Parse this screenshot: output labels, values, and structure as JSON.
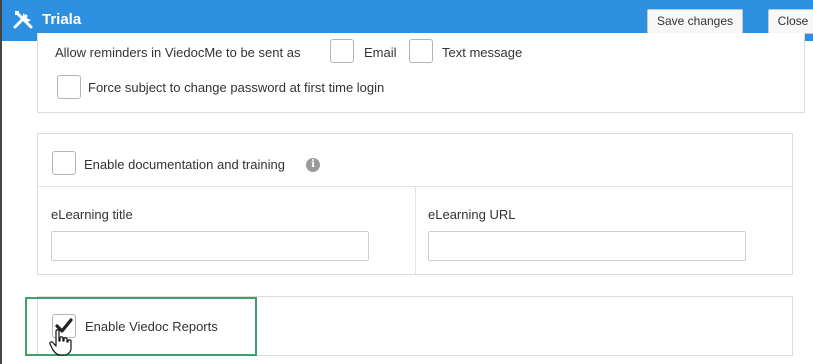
{
  "app": {
    "title": "Triala"
  },
  "toolbar": {
    "save_label": "Save changes",
    "close_label": "Close"
  },
  "reminders": {
    "label": "Allow reminders in ViedocMe to be sent as",
    "email_label": "Email",
    "email_checked": false,
    "sms_label": "Text message",
    "sms_checked": false
  },
  "password": {
    "label": "Force subject to change password at first time login",
    "checked": false
  },
  "documentation": {
    "label": "Enable documentation and training",
    "checked": false,
    "info_icon": "i",
    "elearning_title_label": "eLearning title",
    "elearning_title_value": "",
    "elearning_url_label": "eLearning URL",
    "elearning_url_value": ""
  },
  "reports": {
    "label": "Enable Viedoc Reports",
    "checked": true
  },
  "colors": {
    "titlebar": "#2d8fe0",
    "highlight": "#3aa26a"
  },
  "icons": {
    "app": "tools-icon",
    "checkmark": "checkmark-icon",
    "cursor": "hand-pointer-icon",
    "info": "info-icon"
  }
}
